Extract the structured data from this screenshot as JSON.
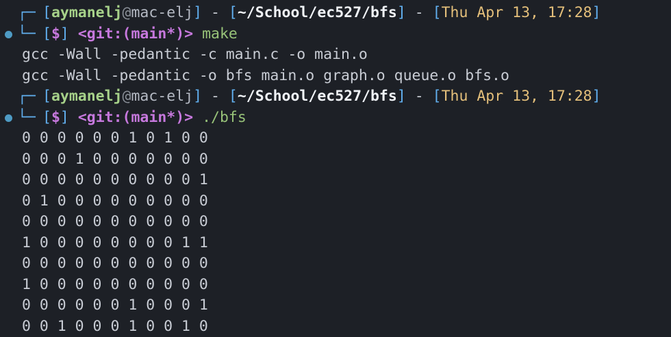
{
  "prompts": [
    {
      "user": "aymanelj",
      "at": "@",
      "host": "mac-elj",
      "path": "~/School/ec527/bfs",
      "date": "Thu Apr 13, 17:28",
      "symbol": "$",
      "git_prefix": "<git:(",
      "branch": "main*",
      "git_suffix": ")>",
      "command": "make"
    },
    {
      "user": "aymanelj",
      "at": "@",
      "host": "mac-elj",
      "path": "~/School/ec527/bfs",
      "date": "Thu Apr 13, 17:28",
      "symbol": "$",
      "git_prefix": "<git:(",
      "branch": "main*",
      "git_suffix": ")>",
      "command": "./bfs"
    }
  ],
  "make_output": [
    "gcc -Wall -pedantic -c main.c -o main.o",
    "gcc -Wall -pedantic -o bfs main.o graph.o queue.o bfs.o"
  ],
  "bfs_output": [
    "0 0 0 0 0 0 1 0 1 0 0",
    "0 0 0 1 0 0 0 0 0 0 0",
    "0 0 0 0 0 0 0 0 0 0 1",
    "0 1 0 0 0 0 0 0 0 0 0",
    "0 0 0 0 0 0 0 0 0 0 0",
    "1 0 0 0 0 0 0 0 0 1 1",
    "0 0 0 0 0 0 0 0 0 0 0",
    "1 0 0 0 0 0 0 0 0 0 0",
    "0 0 0 0 0 0 1 0 0 0 1",
    "0 0 1 0 0 0 1 0 0 1 0"
  ]
}
